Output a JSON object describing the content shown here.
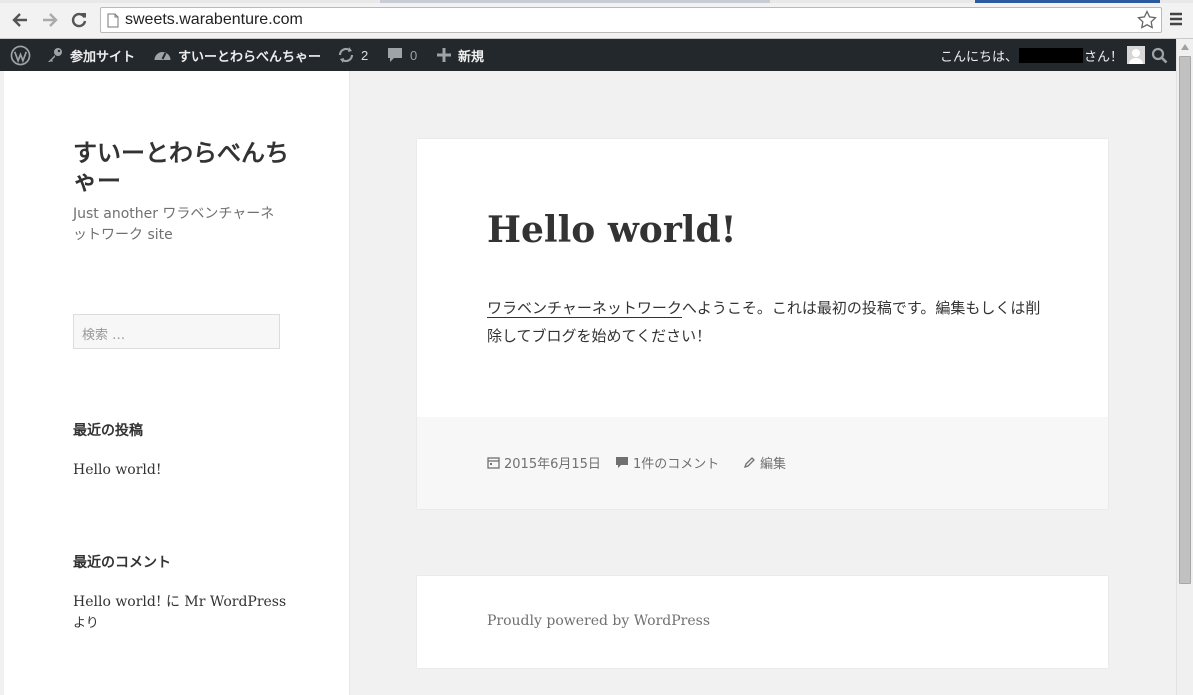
{
  "browser": {
    "url": "sweets.warabenture.com"
  },
  "adminbar": {
    "my_sites": "参加サイト",
    "site_name": "すいーとわらべんちゃー",
    "updates_count": "2",
    "comments_count": "0",
    "new_label": "新規",
    "greeting_prefix": "こんにちは、",
    "greeting_suffix": "さん！"
  },
  "sidebar": {
    "site_title": "すいーとわらべんちゃー",
    "site_description": "Just another ワラベンチャーネットワーク site",
    "search_placeholder": "検索 …",
    "recent_posts_title": "最近の投稿",
    "recent_posts": [
      "Hello world!"
    ],
    "recent_comments_title": "最近のコメント",
    "recent_comment_post": "Hello world!",
    "recent_comment_connector": " に ",
    "recent_comment_author": "Mr WordPress",
    "recent_comment_suffix": "より"
  },
  "post": {
    "title": "Hello world!",
    "body_link": "ワラベンチャーネットワーク",
    "body_text": "へようこそ。これは最初の投稿です。編集もしくは削除してブログを始めてください！",
    "date": "2015年6月15日",
    "comments": "1件のコメント",
    "edit": "編集"
  },
  "footer": {
    "powered_by": "Proudly powered by WordPress"
  },
  "colors": {
    "adminbar_bg": "#23282d",
    "page_bg": "#f1f1f1",
    "text": "#333333",
    "meta": "#707070"
  }
}
